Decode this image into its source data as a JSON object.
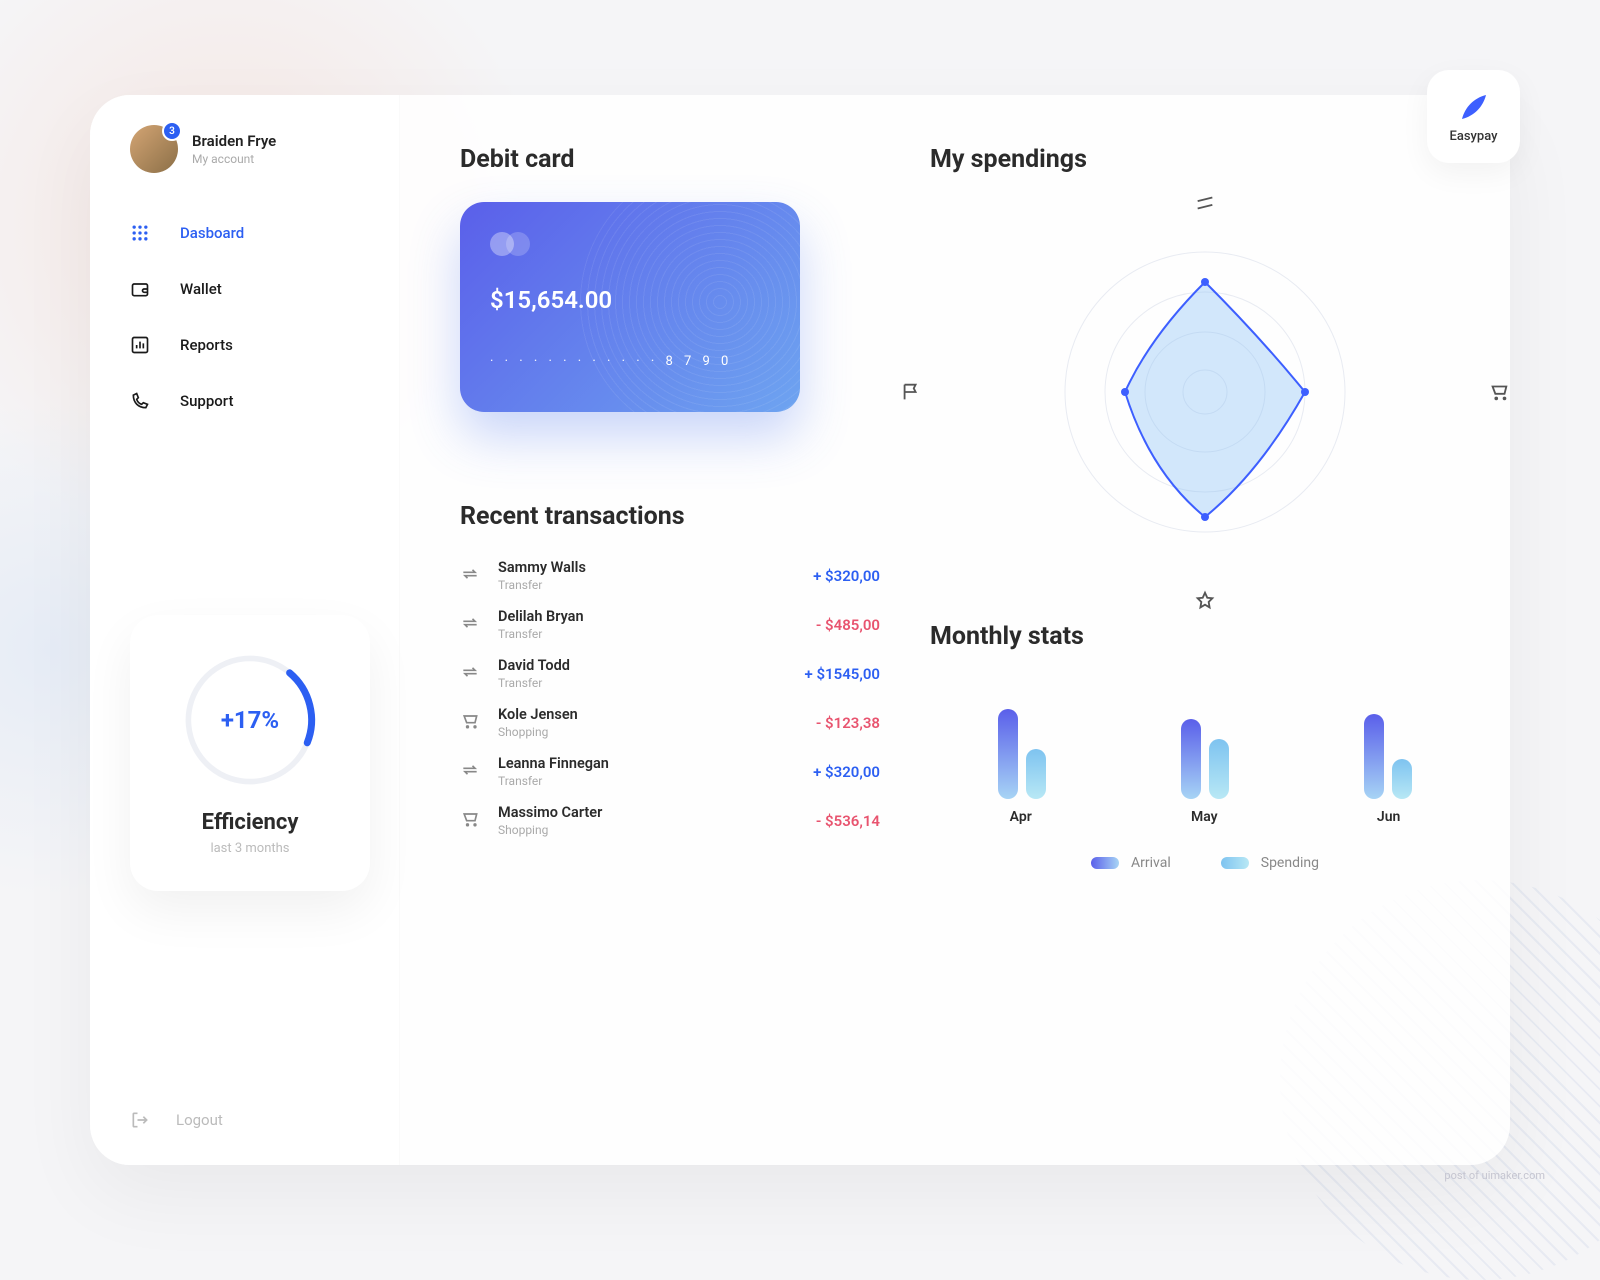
{
  "brand": {
    "name": "Easypay"
  },
  "user": {
    "name": "Braiden Frye",
    "subtitle": "My account",
    "badge": "3"
  },
  "nav": {
    "items": [
      {
        "label": "Dasboard",
        "active": true
      },
      {
        "label": "Wallet"
      },
      {
        "label": "Reports"
      },
      {
        "label": "Support"
      }
    ],
    "logout": "Logout"
  },
  "efficiency": {
    "value": "+17%",
    "title": "Efficiency",
    "subtitle": "last 3 months"
  },
  "debit": {
    "heading": "Debit card",
    "balance": "$15,654.00",
    "number": "· · · ·   · · · ·   · · · ·   8 7 9 0"
  },
  "transactions": {
    "heading": "Recent transactions",
    "items": [
      {
        "name": "Sammy Walls",
        "type": "Transfer",
        "amount": "+ $320,00",
        "dir": "pos",
        "icon": "transfer"
      },
      {
        "name": "Delilah Bryan",
        "type": "Transfer",
        "amount": "- $485,00",
        "dir": "neg",
        "icon": "transfer"
      },
      {
        "name": "David Todd",
        "type": "Transfer",
        "amount": "+ $1545,00",
        "dir": "pos",
        "icon": "transfer"
      },
      {
        "name": "Kole Jensen",
        "type": "Shopping",
        "amount": "- $123,38",
        "dir": "neg",
        "icon": "cart"
      },
      {
        "name": "Leanna Finnegan",
        "type": "Transfer",
        "amount": "+ $320,00",
        "dir": "pos",
        "icon": "transfer"
      },
      {
        "name": "Massimo Carter",
        "type": "Shopping",
        "amount": "- $536,14",
        "dir": "neg",
        "icon": "cart"
      }
    ]
  },
  "spendings": {
    "heading": "My spendings"
  },
  "monthly": {
    "heading": "Monthly stats",
    "legend": {
      "arrival": "Arrival",
      "spending": "Spending"
    }
  },
  "chart_data": [
    {
      "type": "bar",
      "title": "Monthly stats",
      "categories": [
        "Apr",
        "May",
        "Jun"
      ],
      "series": [
        {
          "name": "Arrival",
          "values": [
            90,
            80,
            85
          ]
        },
        {
          "name": "Spending",
          "values": [
            50,
            60,
            40
          ]
        }
      ],
      "ylim": [
        0,
        100
      ]
    },
    {
      "type": "radar",
      "title": "My spendings",
      "axes": [
        "Transfer",
        "Shopping",
        "Flag",
        "Favorite"
      ],
      "values": [
        85,
        70,
        55,
        90
      ]
    }
  ],
  "watermark": "post of uimaker.com"
}
